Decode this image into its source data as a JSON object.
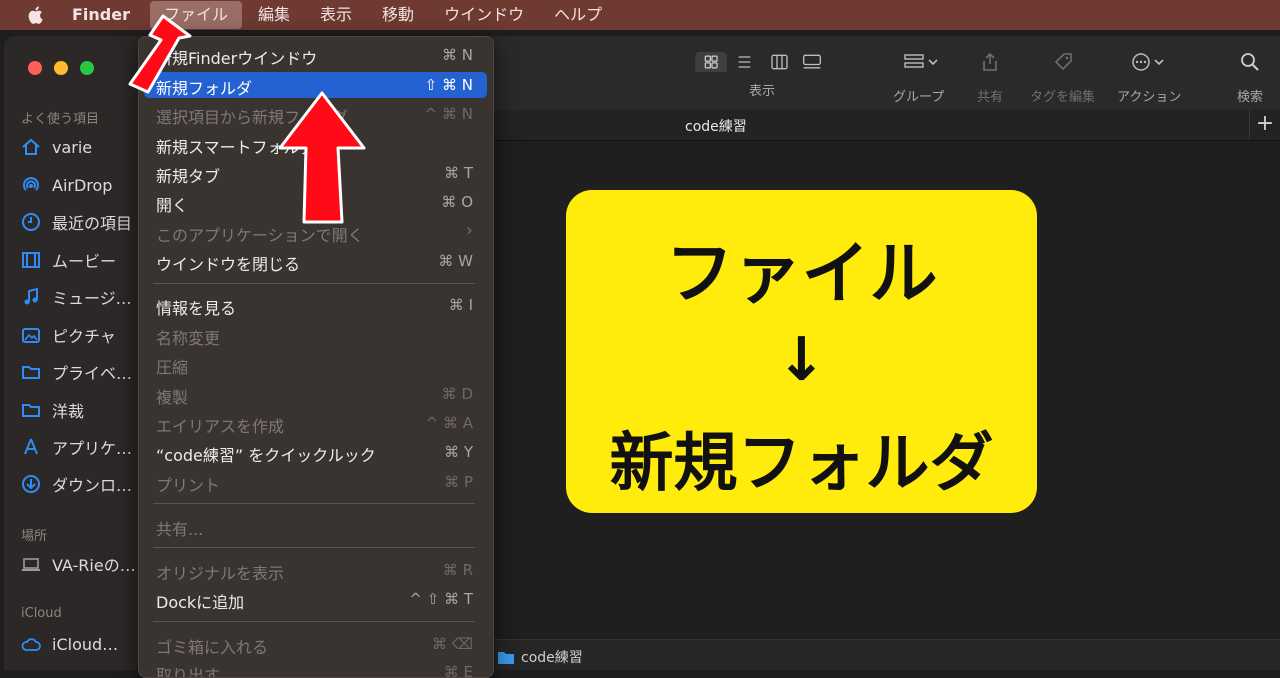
{
  "menubar": {
    "app": "Finder",
    "items": [
      "ファイル",
      "編集",
      "表示",
      "移動",
      "ウインドウ",
      "ヘルプ"
    ]
  },
  "sidebar": {
    "favorites_label": "よく使う項目",
    "favorites": [
      "varie",
      "AirDrop",
      "最近の項目",
      "ムービー",
      "ミュージ…",
      "ピクチャ",
      "プライベ…",
      "洋裁",
      "アプリケ…",
      "ダウンロ…"
    ],
    "locations_label": "場所",
    "locations": [
      "VA-Rieの…"
    ],
    "icloud_label": "iCloud",
    "icloud": [
      "iCloud…"
    ]
  },
  "toolbar": {
    "view": "表示",
    "group": "グループ",
    "share": "共有",
    "tags": "タグを編集",
    "action": "アクション",
    "search": "検索"
  },
  "tab": {
    "title": "code練習",
    "plus": "+"
  },
  "pathbar": {
    "folder": "code練習"
  },
  "menu": {
    "items": [
      {
        "label": "新規Finderウインドウ",
        "shortcut": "⌘ N"
      },
      {
        "label": "新規フォルダ",
        "shortcut": "⇧ ⌘ N"
      },
      {
        "label": "選択項目から新規フォルダ",
        "shortcut": "^ ⌘ N"
      },
      {
        "label": "新規スマートフォルダ",
        "shortcut": ""
      },
      {
        "label": "新規タブ",
        "shortcut": "⌘ T"
      },
      {
        "label": "開く",
        "shortcut": "⌘ O"
      },
      {
        "label": "このアプリケーションで開く",
        "shortcut": "›"
      },
      {
        "label": "ウインドウを閉じる",
        "shortcut": "⌘ W"
      },
      {
        "label": "情報を見る",
        "shortcut": "⌘ I"
      },
      {
        "label": "名称変更",
        "shortcut": ""
      },
      {
        "label": "圧縮",
        "shortcut": ""
      },
      {
        "label": "複製",
        "shortcut": "⌘ D"
      },
      {
        "label": "エイリアスを作成",
        "shortcut": "^ ⌘ A"
      },
      {
        "label": "“code練習” をクイックルック",
        "shortcut": "⌘ Y"
      },
      {
        "label": "プリント",
        "shortcut": "⌘ P"
      },
      {
        "label": "共有...",
        "shortcut": ""
      },
      {
        "label": "オリジナルを表示",
        "shortcut": "⌘ R"
      },
      {
        "label": "Dockに追加",
        "shortcut": "^ ⇧ ⌘ T"
      },
      {
        "label": "ゴミ箱に入れる",
        "shortcut": "⌘ ⌫"
      },
      {
        "label": "取り出す",
        "shortcut": "⌘ E"
      }
    ]
  },
  "callout": {
    "line1": "ファイル",
    "line2": "↓",
    "line3": "新規フォルダ"
  },
  "colors": {
    "menubar": "#6e3a32",
    "highlight": "#2362d0",
    "callout": "#ffec0d",
    "arrow": "#ff0a16"
  }
}
